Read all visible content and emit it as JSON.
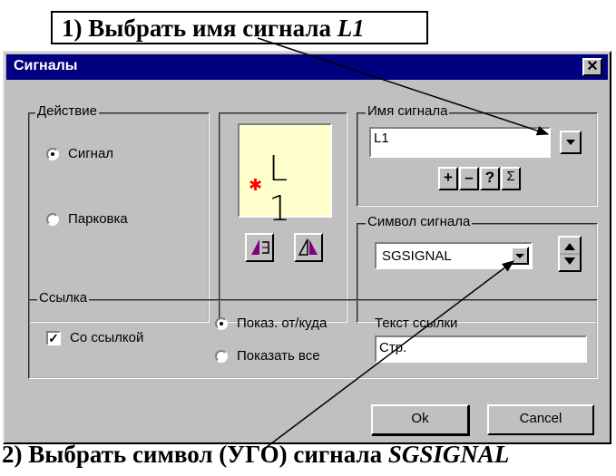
{
  "callout1": {
    "prefix": "1) Выбрать имя сигнала ",
    "emph": "L1"
  },
  "callout2": {
    "prefix": "2) Выбрать символ (УГО) сигнала ",
    "emph": "SGSIGNAL"
  },
  "dialog": {
    "title": "Сигналы",
    "close_glyph": "✕",
    "action_group": {
      "legend": "Действие",
      "options": [
        {
          "label": "Сигнал",
          "selected": true
        },
        {
          "label": "Парковка",
          "selected": false
        }
      ]
    },
    "preview": {
      "text": "L 1",
      "marker": "✱"
    },
    "signal_name": {
      "legend": "Имя сигнала",
      "value": "L1",
      "buttons": [
        "+",
        "–",
        "?",
        "Σ"
      ]
    },
    "signal_symbol": {
      "legend": "Символ сигнала",
      "value": "SGSIGNAL"
    },
    "link_group": {
      "legend": "Ссылка",
      "checkbox_label": "Со ссылкой",
      "checkbox_checked": true,
      "radios": [
        {
          "label": "Показ. от/куда",
          "selected": true
        },
        {
          "label": "Показать все",
          "selected": false
        }
      ],
      "link_text_label": "Текст ссылки",
      "link_text_value": "Стр."
    },
    "ok_label": "Ok",
    "cancel_label": "Cancel"
  },
  "colors": {
    "titlebar": "#000080",
    "preview_bg": "#ffffcc",
    "marker": "#ff0000",
    "dialog_bg": "#c0c0c0"
  }
}
